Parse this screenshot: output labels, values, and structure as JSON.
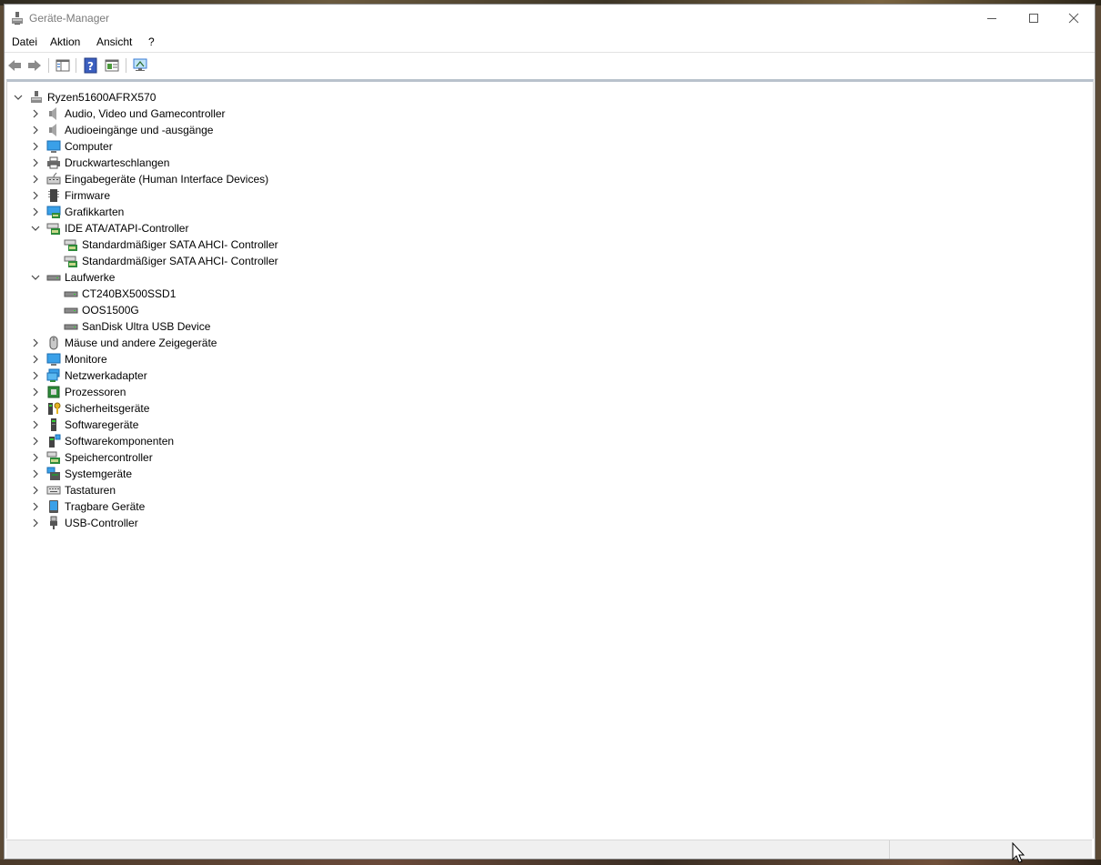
{
  "window": {
    "title": "Geräte-Manager"
  },
  "menu": [
    "Datei",
    "Aktion",
    "Ansicht",
    "?"
  ],
  "toolbar": {
    "buttons": [
      "back-arrow-icon",
      "forward-arrow-icon",
      "console-tree-icon",
      "help-icon",
      "properties-view-icon",
      "scan-hardware-icon"
    ]
  },
  "tree": {
    "root": "Ryzen51600AFRX570",
    "categories": [
      "Audio, Video und Gamecontroller",
      "Audioeingänge und -ausgänge",
      "Computer",
      "Druckwarteschlangen",
      "Eingabegeräte (Human Interface Devices)",
      "Firmware",
      "Grafikkarten",
      "IDE ATA/ATAPI-Controller",
      "Laufwerke",
      "Mäuse und andere Zeigegeräte",
      "Monitore",
      "Netzwerkadapter",
      "Prozessoren",
      "Sicherheitsgeräte",
      "Softwaregeräte",
      "Softwarekomponenten",
      "Speichercontroller",
      "Systemgeräte",
      "Tastaturen",
      "Tragbare Geräte",
      "USB-Controller"
    ],
    "ide_children": [
      "Standardmäßiger SATA AHCI- Controller",
      "Standardmäßiger SATA AHCI- Controller"
    ],
    "drive_children": [
      "CT240BX500SSD1",
      "OOS1500G",
      "SanDisk Ultra USB Device"
    ],
    "expanded": [
      "IDE ATA/ATAPI-Controller",
      "Laufwerke"
    ]
  },
  "colors": {
    "title_text": "#7a7a7a",
    "tree_border": "#b9c2cc",
    "statusbar": "#f0f0f0"
  }
}
